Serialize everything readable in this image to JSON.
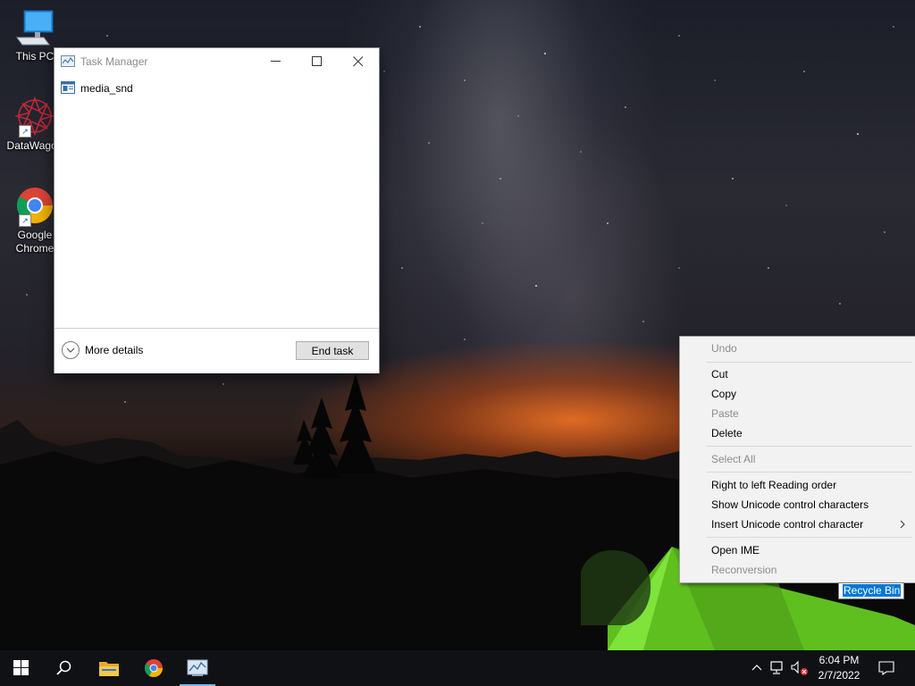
{
  "desktop": {
    "icons": [
      {
        "label": "This PC",
        "icon": "monitor-icon"
      },
      {
        "label": "DataWagon",
        "icon": "datawagon-logo-icon"
      },
      {
        "label": "Google Chrome",
        "label_line1": "Google",
        "label_line2": "Chrome",
        "icon": "chrome-icon"
      }
    ],
    "rename_text": "Recycle Bin"
  },
  "task_manager": {
    "title": "Task Manager",
    "processes": [
      {
        "name": "media_snd",
        "icon": "app-window-icon"
      }
    ],
    "more_details_label": "More details",
    "end_task_label": "End task"
  },
  "context_menu": {
    "items": [
      {
        "label": "Undo",
        "enabled": false
      },
      {
        "label": "Cut",
        "enabled": true
      },
      {
        "label": "Copy",
        "enabled": true
      },
      {
        "label": "Paste",
        "enabled": false
      },
      {
        "label": "Delete",
        "enabled": true
      },
      {
        "label": "Select All",
        "enabled": false
      },
      {
        "label": "Right to left Reading order",
        "enabled": true
      },
      {
        "label": "Show Unicode control characters",
        "enabled": true
      },
      {
        "label": "Insert Unicode control character",
        "enabled": true,
        "submenu": true
      },
      {
        "label": "Open IME",
        "enabled": true
      },
      {
        "label": "Reconversion",
        "enabled": false
      }
    ]
  },
  "taskbar": {
    "apps": [
      "start-icon",
      "search-icon",
      "file-explorer-icon",
      "chrome-icon",
      "task-manager-icon"
    ],
    "active_app": "task-manager-icon",
    "tray_icons": [
      "chevron-up-icon",
      "network-icon",
      "volume-muted-icon"
    ],
    "clock": {
      "time": "6:04 PM",
      "date": "2/7/2022"
    },
    "notification_icon": "action-center-icon"
  },
  "colors": {
    "accent": "#0078d7",
    "taskbar": "#101114",
    "menu_bg": "#f2f2f2",
    "disabled_text": "#8d8d8d"
  }
}
